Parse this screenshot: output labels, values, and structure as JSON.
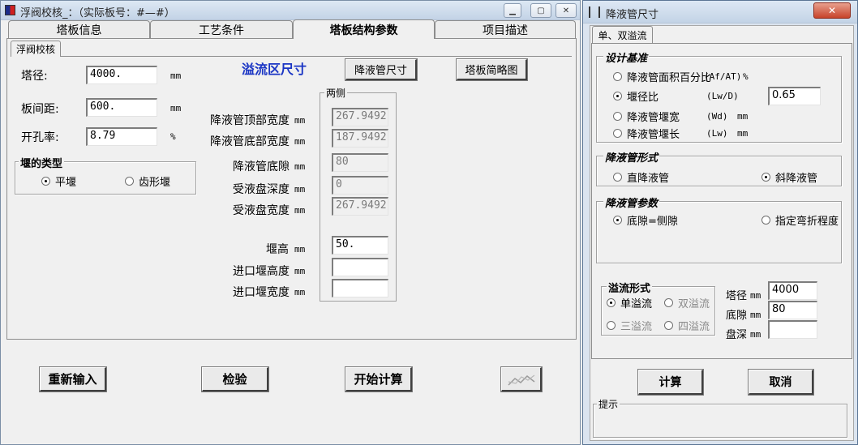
{
  "main_window": {
    "title": "浮阀校核_：（实际板号：#—#）",
    "tabs": [
      "塔板信息",
      "工艺条件",
      "塔板结构参数",
      "项目描述"
    ],
    "active_tab": 2,
    "subtab": "浮阀校核",
    "fields": {
      "diameter": {
        "label": "塔径:",
        "value": "4000.",
        "unit": "mm"
      },
      "spacing": {
        "label": "板间距:",
        "value": "600.",
        "unit": "mm"
      },
      "open_ratio": {
        "label": "开孔率:",
        "value": "8.79",
        "unit": "%"
      }
    },
    "weir_type": {
      "title": "堰的类型",
      "options": [
        {
          "label": "平堰",
          "selected": true
        },
        {
          "label": "齿形堰",
          "selected": false
        }
      ]
    },
    "overflow_title": "溢流区尺寸",
    "downcomer_btn": "降液管尺寸",
    "sketch_btn": "塔板简略图",
    "side_group_title": "两侧",
    "unit_mm": "mm",
    "side_fields": [
      {
        "label": "降液管顶部宽度",
        "value": "267.9492",
        "disabled": true
      },
      {
        "label": "降液管底部宽度",
        "value": "187.9492",
        "disabled": true
      },
      {
        "label": "降液管底隙",
        "value": "80",
        "disabled": true
      },
      {
        "label": "受液盘深度",
        "value": "0",
        "disabled": true
      },
      {
        "label": "受液盘宽度",
        "value": "267.9492",
        "disabled": true
      },
      {
        "label": "堰高",
        "value": "50.",
        "disabled": false
      },
      {
        "label": "进口堰高度",
        "value": "",
        "disabled": false
      },
      {
        "label": "进口堰宽度",
        "value": "",
        "disabled": false
      }
    ],
    "buttons": {
      "reset": "重新输入",
      "check": "检验",
      "calculate": "开始计算"
    }
  },
  "dialog": {
    "title": "降液管尺寸",
    "tab": "单、双溢流",
    "design_basis": {
      "title": "设计基准",
      "options": [
        {
          "label": "降液管面积百分比",
          "code": "(Af/AT)",
          "unit": "%",
          "selected": false
        },
        {
          "label": "堰径比",
          "code": "(Lw/D)",
          "unit": "",
          "selected": true
        },
        {
          "label": "降液管堰宽",
          "code": "(Wd)",
          "unit": "mm",
          "selected": false
        },
        {
          "label": "降液管堰长",
          "code": "(Lw)",
          "unit": "mm",
          "selected": false
        }
      ],
      "value": "0.65"
    },
    "downcomer_form": {
      "title": "降液管形式",
      "options": [
        {
          "label": "直降液管",
          "selected": false
        },
        {
          "label": "斜降液管",
          "selected": true
        }
      ]
    },
    "downcomer_params": {
      "title": "降液管参数",
      "options": [
        {
          "label": "底隙=侧隙",
          "selected": true
        },
        {
          "label": "指定弯折程度",
          "selected": false
        }
      ]
    },
    "overflow_form": {
      "title": "溢流形式",
      "options": [
        {
          "label": "单溢流",
          "selected": true,
          "disabled": false
        },
        {
          "label": "双溢流",
          "selected": false,
          "disabled": true
        },
        {
          "label": "三溢流",
          "selected": false,
          "disabled": true
        },
        {
          "label": "四溢流",
          "selected": false,
          "disabled": true
        }
      ]
    },
    "params": [
      {
        "label": "塔径",
        "unit": "mm",
        "value": "4000"
      },
      {
        "label": "底隙",
        "unit": "mm",
        "value": "80"
      },
      {
        "label": "盘深",
        "unit": "mm",
        "value": ""
      }
    ],
    "calc_btn": "计算",
    "cancel_btn": "取消",
    "hint_title": "提示"
  },
  "colors": {
    "accent_title": "#1a35c4",
    "dialog_title_italic": "#000000"
  }
}
